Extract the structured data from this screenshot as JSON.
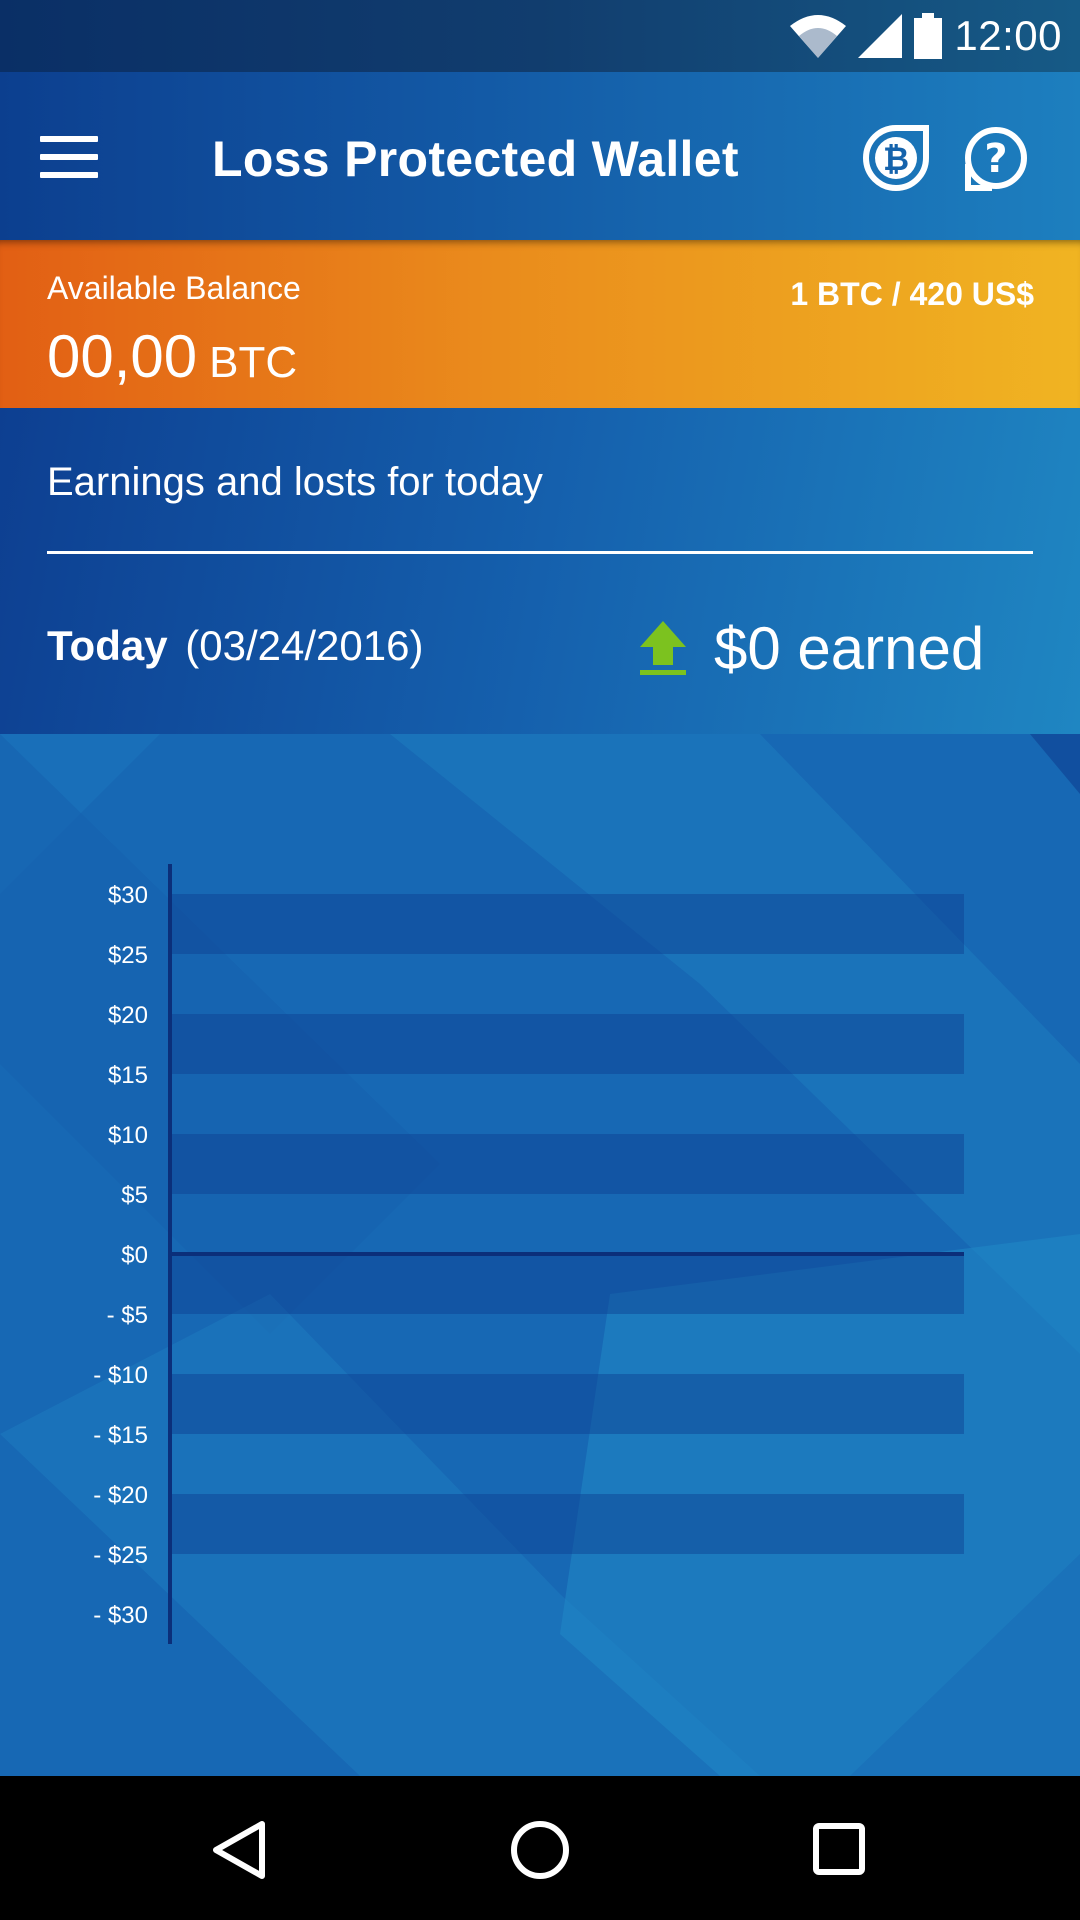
{
  "status_bar": {
    "time": "12:00",
    "icons": [
      "wifi-icon",
      "signal-icon",
      "battery-icon"
    ]
  },
  "header": {
    "title": "Loss Protected Wallet",
    "menu_icon": "hamburger-menu-icon",
    "actions": [
      "bitcoin-icon",
      "help-icon"
    ]
  },
  "balance": {
    "label": "Available Balance",
    "amount": "00,00",
    "unit": "BTC",
    "rate": "1 BTC / 420 US$"
  },
  "earnings": {
    "heading": "Earnings and losts for today",
    "today_label": "Today",
    "date": "(03/24/2016)",
    "earned_text": "$0 earned",
    "trend_icon": "upload-arrow-icon",
    "trend_color": "#7cc21f"
  },
  "chart_data": {
    "type": "bar",
    "title": "",
    "xlabel": "",
    "ylabel": "",
    "ylim": [
      -30,
      30
    ],
    "ytick_step": 5,
    "ytick_labels": [
      "$30",
      "$25",
      "$20",
      "$15",
      "$10",
      "$5",
      "$0",
      "- $5",
      "- $10",
      "- $15",
      "- $20",
      "- $25",
      "- $30"
    ],
    "categories": [],
    "values": [],
    "band_color": "#0d3f91",
    "axis_color": "#0b2f7a"
  },
  "nav": {
    "back_icon": "back-triangle-icon",
    "home_icon": "home-circle-icon",
    "recents_icon": "recents-square-icon"
  }
}
